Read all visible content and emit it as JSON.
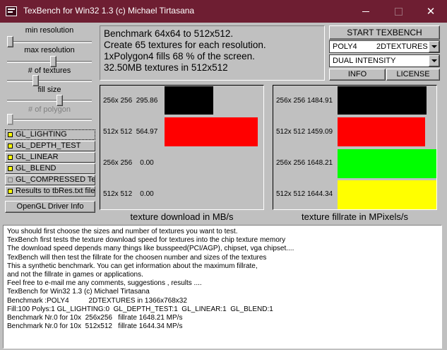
{
  "window": {
    "title": "TexBench for Win32 1.3 (c) Michael Tirtasana",
    "minimize_glyph": "",
    "maximize_glyph": "",
    "close_glyph": "✕"
  },
  "sliders": {
    "min_resolution": {
      "label": "min resolution",
      "value": 0.0
    },
    "max_resolution": {
      "label": "max resolution",
      "value": 0.55
    },
    "num_textures": {
      "label": "# of textures",
      "value": 0.32
    },
    "fill_size": {
      "label": "fill size",
      "value": 0.63
    },
    "num_polygon": {
      "label": "# of polygon",
      "value": 0.0
    }
  },
  "checkboxes": [
    {
      "label": "GL_LIGHTING",
      "checked": true
    },
    {
      "label": "GL_DEPTH_TEST",
      "checked": true
    },
    {
      "label": "GL_LINEAR",
      "checked": true
    },
    {
      "label": "GL_BLEND",
      "checked": true
    },
    {
      "label": "GL_COMPRESSED Tex",
      "checked": false
    },
    {
      "label": "Results to tbRes.txt file",
      "checked": true
    }
  ],
  "driver_button": "OpenGL Driver Info",
  "info_lines": [
    "Benchmark 64x64 to 512x512.",
    "Create 65 textures for each resolution.",
    "1xPolygon4 fills 68 % of the screen.",
    "32.50MB textures in 512x512"
  ],
  "start_button": "START TEXBENCH",
  "combo_mode": {
    "value": "POLY4",
    "value2": "2DTEXTURES"
  },
  "combo_light": {
    "value": "DUAL INTENSITY"
  },
  "info_button": "INFO",
  "license_button": "LICENSE",
  "chart_data": [
    {
      "type": "bar",
      "title": "texture download in MB/s",
      "categories": [
        "256x 256",
        "512x 512",
        "256x 256",
        "512x 512"
      ],
      "values": [
        295.86,
        564.97,
        0.0,
        0.0
      ],
      "value_labels": [
        "295.86",
        "564.97",
        "0.00",
        "0.00"
      ],
      "colors": [
        "#000000",
        "#ff0000",
        "#00ff00",
        "#ffff00"
      ],
      "max": 600
    },
    {
      "type": "bar",
      "title": "texture fillrate in MPixels/s",
      "categories": [
        "256x 256",
        "512x 512",
        "256x 256",
        "512x 512"
      ],
      "values": [
        1484.91,
        1459.09,
        1648.21,
        1644.34
      ],
      "value_labels": [
        "1484.91",
        "1459.09",
        "1648.21",
        "1644.34"
      ],
      "colors": [
        "#000000",
        "#ff0000",
        "#00ff00",
        "#ffff00"
      ],
      "max": 1650
    }
  ],
  "log_lines": [
    "You should first choose the sizes and number of textures you want to test.",
    "TexBench first tests the texture download speed for textures into the chip texture memory",
    "The download speed depends many things like busspeed(PCI/AGP), chipset, vga chipset....",
    "TexBench will then test the fillrate for the choosen number and sizes of the textures",
    "This a synthetic benchmark. You can get information about the maximum fillrate,",
    "and not the fillrate in games or applications.",
    "Feel free to e-mail me any comments, suggestions , results ....",
    "TexBench for Win32 1.3 (c) Michael Tirtasana",
    "Benchmark :POLY4          2DTEXTURES in 1366x768x32",
    "Fill:100 Polys:1 GL_LIGHTING:0  GL_DEPTH_TEST:1  GL_LINEAR:1  GL_BLEND:1",
    "Benchmark Nr.0 for 10x  256x256   fillrate 1648.21 MP/s",
    "Benchmark Nr.0 for 10x  512x512   fillrate 1644.34 MP/s"
  ]
}
